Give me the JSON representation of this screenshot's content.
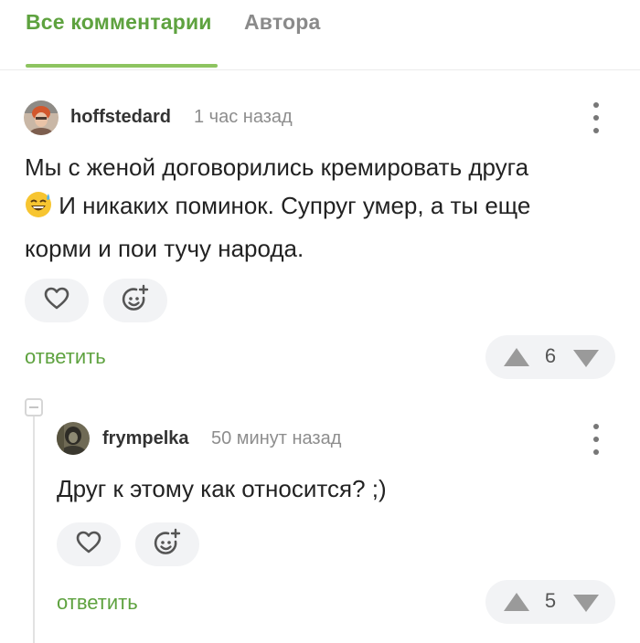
{
  "tabs": {
    "all_comments": "Все комментарии",
    "author": "Автора"
  },
  "comments": [
    {
      "username": "hoffstedard",
      "time": "1 час назад",
      "text_line1": "Мы с женой договорились кремировать друга",
      "emoji": "sweat-smile-emoji",
      "text_line2": "И никаких поминок. Супруг умер, а ты еще",
      "text_line3": "корми и пои тучу народа.",
      "reply_label": "ответить",
      "rating": "6"
    },
    {
      "username": "frympelka",
      "time": "50 минут назад",
      "text": "Друг к этому как относится? ;)",
      "reply_label": "ответить",
      "rating": "5"
    }
  ],
  "colors": {
    "accent": "#5ea23f",
    "tab_underline": "#8dc460",
    "muted": "#8d8d8d",
    "pill_bg": "#f2f3f5",
    "icon": "#555555",
    "vote_arrow": "#9a9a9a"
  },
  "icons": {
    "like": "heart-icon",
    "react": "add-emoji-icon",
    "upvote": "upvote-arrow-icon",
    "downvote": "downvote-arrow-icon",
    "menu": "more-vertical-icon",
    "collapse": "collapse-thread-icon"
  }
}
